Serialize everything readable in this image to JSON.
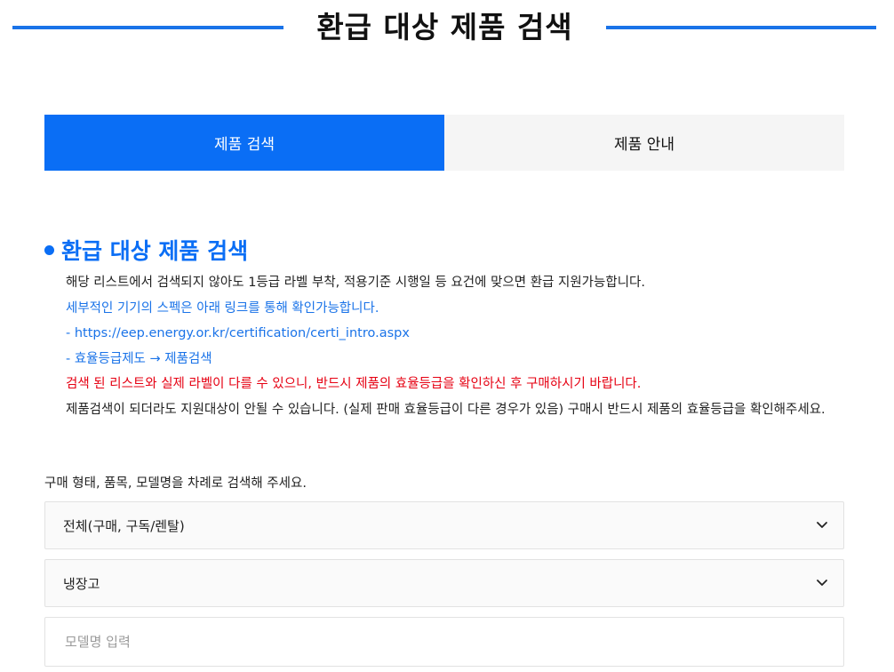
{
  "header": {
    "title": "환급 대상 제품 검색"
  },
  "tabs": [
    {
      "label": "제품 검색",
      "active": true
    },
    {
      "label": "제품 안내",
      "active": false
    }
  ],
  "section": {
    "title": "환급 대상 제품 검색",
    "lines": {
      "notice": "해당 리스트에서 검색되지 않아도 1등급 라벨 부착, 적용기준 시행일 등 요건에 맞으면 환급 지원가능합니다.",
      "spec": "세부적인 기기의 스펙은 아래 링크를 통해 확인가능합니다.",
      "link_url": "- https://eep.energy.or.kr/certification/certi_intro.aspx",
      "link_path": "- 효율등급제도 → 제품검색",
      "warning": "검색 된 리스트와 실제 라벨이 다를 수 있으니, 반드시 제품의 효율등급을 확인하신 후 구매하시기 바랍니다.",
      "caution": "제품검색이 되더라도 지원대상이 안될 수 있습니다. (실제 판매 효율등급이 다른 경우가 있음) 구매시 반드시 제품의 효율등급을 확인해주세요."
    }
  },
  "form": {
    "instruction": "구매 형태, 품목, 모델명을 차례로 검색해 주세요.",
    "purchase_type": {
      "selected": "전체(구매, 구독/렌탈)"
    },
    "product": {
      "selected": "냉장고"
    },
    "model": {
      "placeholder": "모델명 입력",
      "value": ""
    }
  },
  "icons": {
    "select_arrow": "chevron-down-icon"
  },
  "colors": {
    "accent": "#0a6ef5",
    "link": "#1a73e8",
    "warning": "#e60012",
    "tab_inactive_bg": "#f5f5f5"
  }
}
